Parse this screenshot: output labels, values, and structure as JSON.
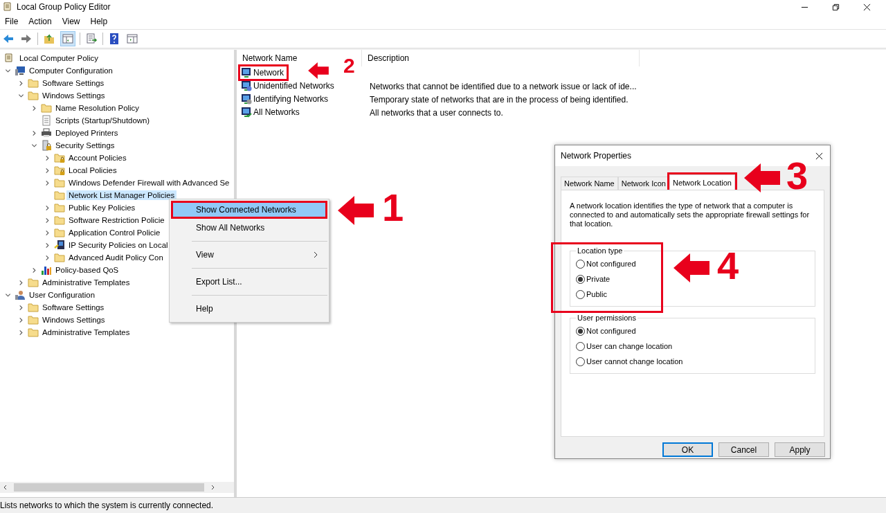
{
  "window": {
    "title": "Local Group Policy Editor"
  },
  "menu_bar": [
    "File",
    "Action",
    "View",
    "Help"
  ],
  "tree": {
    "root": "Local Computer Policy",
    "items": [
      {
        "label": "Computer Configuration",
        "kind": "computer",
        "expandable": true,
        "expanded": true,
        "selected": false,
        "children": [
          {
            "label": "Software Settings",
            "kind": "folder",
            "expandable": true,
            "expanded": false,
            "selected": false
          },
          {
            "label": "Windows Settings",
            "kind": "folder",
            "expandable": true,
            "expanded": true,
            "selected": false,
            "children": [
              {
                "label": "Name Resolution Policy",
                "kind": "folder",
                "expandable": true,
                "expanded": false,
                "selected": false
              },
              {
                "label": "Scripts (Startup/Shutdown)",
                "kind": "script",
                "expandable": false,
                "expanded": false,
                "selected": false
              },
              {
                "label": "Deployed Printers",
                "kind": "printer",
                "expandable": true,
                "expanded": false,
                "selected": false
              },
              {
                "label": "Security Settings",
                "kind": "security",
                "expandable": true,
                "expanded": true,
                "selected": false,
                "children": [
                  {
                    "label": "Account Policies",
                    "kind": "folder-lock",
                    "expandable": true,
                    "expanded": false,
                    "selected": false
                  },
                  {
                    "label": "Local Policies",
                    "kind": "folder-lock",
                    "expandable": true,
                    "expanded": false,
                    "selected": false
                  },
                  {
                    "label": "Windows Defender Firewall with Advanced Se",
                    "kind": "folder",
                    "expandable": true,
                    "expanded": false,
                    "selected": false
                  },
                  {
                    "label": "Network List Manager Policies",
                    "kind": "folder",
                    "expandable": false,
                    "expanded": false,
                    "selected": true
                  },
                  {
                    "label": "Public Key Policies",
                    "kind": "folder",
                    "expandable": true,
                    "expanded": false,
                    "selected": false
                  },
                  {
                    "label": "Software Restriction Policie",
                    "kind": "folder",
                    "expandable": true,
                    "expanded": false,
                    "selected": false
                  },
                  {
                    "label": "Application Control Policie",
                    "kind": "folder",
                    "expandable": true,
                    "expanded": false,
                    "selected": false
                  },
                  {
                    "label": "IP Security Policies on Local",
                    "kind": "ip-security",
                    "expandable": true,
                    "expanded": false,
                    "selected": false
                  },
                  {
                    "label": "Advanced Audit Policy Con",
                    "kind": "folder",
                    "expandable": true,
                    "expanded": false,
                    "selected": false
                  }
                ]
              },
              {
                "label": "Policy-based QoS",
                "kind": "chart",
                "expandable": true,
                "expanded": false,
                "selected": false
              }
            ]
          },
          {
            "label": "Administrative Templates",
            "kind": "folder",
            "expandable": true,
            "expanded": false,
            "selected": false
          }
        ]
      },
      {
        "label": "User Configuration",
        "kind": "user",
        "expandable": true,
        "expanded": true,
        "selected": false,
        "children": [
          {
            "label": "Software Settings",
            "kind": "folder",
            "expandable": true,
            "expanded": false,
            "selected": false
          },
          {
            "label": "Windows Settings",
            "kind": "folder",
            "expandable": true,
            "expanded": false,
            "selected": false
          },
          {
            "label": "Administrative Templates",
            "kind": "folder",
            "expandable": true,
            "expanded": false,
            "selected": false
          }
        ]
      }
    ]
  },
  "context_menu": [
    {
      "label": "Show Connected Networks",
      "selected": true,
      "submenu": false,
      "separator_before": false,
      "annotated": true
    },
    {
      "label": "Show All Networks",
      "selected": false,
      "submenu": false,
      "separator_before": false,
      "annotated": false
    },
    {
      "label": "View",
      "selected": false,
      "submenu": true,
      "separator_before": true,
      "annotated": false
    },
    {
      "label": "Export List...",
      "selected": false,
      "submenu": false,
      "separator_before": true,
      "annotated": false
    },
    {
      "label": "Help",
      "selected": false,
      "submenu": false,
      "separator_before": true,
      "annotated": false
    }
  ],
  "list": {
    "columns": [
      "Network Name",
      "Description"
    ],
    "rows": [
      {
        "name": "Network",
        "description": "",
        "kind": "connected",
        "annotated": true
      },
      {
        "name": "Unidentified Networks",
        "description": "Networks that cannot be identified due to a network issue or lack of ide...",
        "kind": "unknown",
        "annotated": false
      },
      {
        "name": "Identifying Networks",
        "description": "Temporary state of networks that are in the process of being identified.",
        "kind": "pending",
        "annotated": false
      },
      {
        "name": "All Networks",
        "description": "All networks that a user connects to.",
        "kind": "ok",
        "annotated": false
      }
    ]
  },
  "dialog": {
    "title": "Network Properties",
    "tabs": [
      {
        "label": "Network Name",
        "selected": false,
        "annotated": false
      },
      {
        "label": "Network Icon",
        "selected": false,
        "annotated": false
      },
      {
        "label": "Network Location",
        "selected": true,
        "annotated": true
      }
    ],
    "description": "A network location identifies the type of network that a computer is connected to and automatically sets the appropriate firewall settings for that location.",
    "groups": [
      {
        "title": "Location type",
        "annotated": true,
        "options": [
          {
            "label": "Not configured",
            "selected": false
          },
          {
            "label": "Private",
            "selected": true
          },
          {
            "label": "Public",
            "selected": false
          }
        ]
      },
      {
        "title": "User permissions",
        "annotated": false,
        "options": [
          {
            "label": "Not configured",
            "selected": true
          },
          {
            "label": "User can change location",
            "selected": false
          },
          {
            "label": "User cannot change location",
            "selected": false
          }
        ]
      }
    ],
    "buttons": [
      {
        "label": "OK",
        "default": true
      },
      {
        "label": "Cancel",
        "default": false
      },
      {
        "label": "Apply",
        "default": false
      }
    ]
  },
  "callouts": [
    "1",
    "2",
    "3",
    "4"
  ],
  "status_bar": "Lists networks to which the system is currently connected."
}
